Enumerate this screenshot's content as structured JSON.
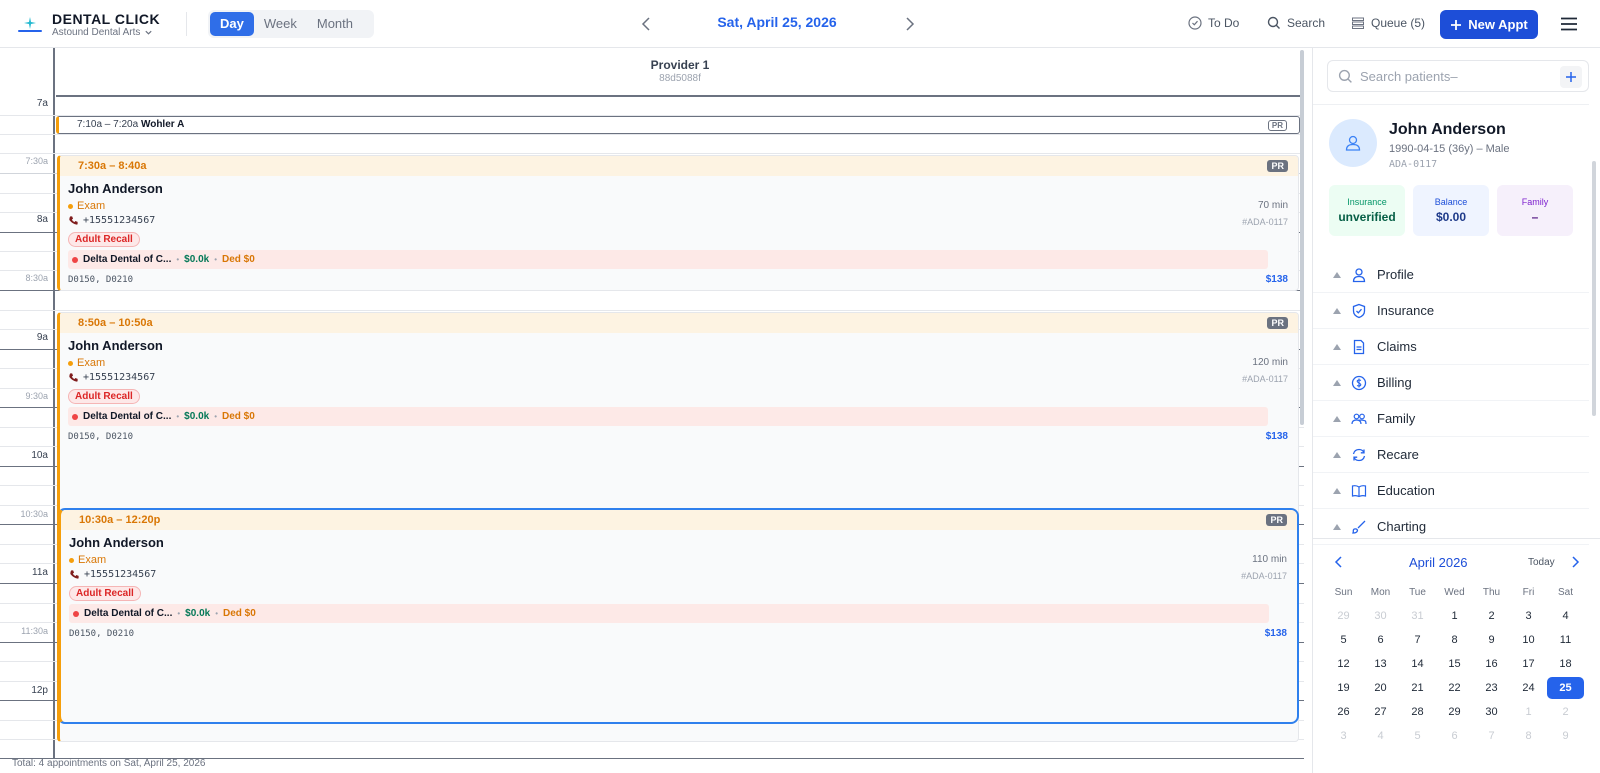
{
  "header": {
    "brand": "DENTAL CLICK",
    "practice": "Astound Dental Arts",
    "views": [
      "Day",
      "Week",
      "Month"
    ],
    "active_view": "Day",
    "date": "Sat, April 25, 2026",
    "todo_label": "To Do",
    "search_label": "Search",
    "queue_label": "Queue (5)",
    "new_appt_label": "New Appt"
  },
  "schedule": {
    "provider_name": "Provider 1",
    "provider_id": "88d5088f",
    "time_labels": {
      "t7": "7a",
      "t730": "7:30a",
      "t8": "8a",
      "t830": "8:30a",
      "t9": "9a",
      "t930": "9:30a",
      "t10": "10a",
      "t1030": "10:30a",
      "t11": "11a",
      "t1130": "11:30a",
      "t12": "12p"
    },
    "small_appt": {
      "time": "7:10a – 7:20a",
      "name": "Wohler A",
      "badge": "PR"
    },
    "appointments": [
      {
        "time": "7:30a – 8:40a",
        "badge": "PR",
        "name": "John Anderson",
        "type": "Exam",
        "phone": "+15551234567",
        "recall": "Adult Recall",
        "carrier": "Delta Dental of C...",
        "amount": "$0.0k",
        "ded": "Ded $0",
        "codes": "D0150, D0210",
        "duration": "70 min",
        "pid": "#ADA-0117",
        "price": "$138"
      },
      {
        "time": "8:50a – 10:50a",
        "badge": "PR",
        "name": "John Anderson",
        "type": "Exam",
        "phone": "+15551234567",
        "recall": "Adult Recall",
        "carrier": "Delta Dental of C...",
        "amount": "$0.0k",
        "ded": "Ded $0",
        "codes": "D0150, D0210",
        "duration": "120 min",
        "pid": "#ADA-0117",
        "price": "$138"
      },
      {
        "time": "10:30a – 12:20p",
        "badge": "PR",
        "name": "John Anderson",
        "type": "Exam",
        "phone": "+15551234567",
        "recall": "Adult Recall",
        "carrier": "Delta Dental of C...",
        "amount": "$0.0k",
        "ded": "Ded $0",
        "codes": "D0150, D0210",
        "duration": "110 min",
        "pid": "#ADA-0117",
        "price": "$138"
      }
    ],
    "footer": "Total: 4 appointments on Sat, April 25, 2026"
  },
  "panel": {
    "search_placeholder": "Search patients–",
    "patient": {
      "name": "John Anderson",
      "dob": "1990-04-15 (36y) – Male",
      "code": "ADA-0117",
      "insurance_label": "Insurance",
      "insurance_value": "unverified",
      "balance_label": "Balance",
      "balance_value": "$0.00",
      "family_label": "Family",
      "family_value": "–"
    },
    "menu": [
      "Profile",
      "Insurance",
      "Claims",
      "Billing",
      "Family",
      "Recare",
      "Education",
      "Charting"
    ],
    "calendar": {
      "month": "April 2026",
      "today_label": "Today",
      "dow": [
        "Sun",
        "Mon",
        "Tue",
        "Wed",
        "Thu",
        "Fri",
        "Sat"
      ],
      "weeks": [
        [
          "29",
          "30",
          "31",
          "1",
          "2",
          "3",
          "4"
        ],
        [
          "5",
          "6",
          "7",
          "8",
          "9",
          "10",
          "11"
        ],
        [
          "12",
          "13",
          "14",
          "15",
          "16",
          "17",
          "18"
        ],
        [
          "19",
          "20",
          "21",
          "22",
          "23",
          "24",
          "25"
        ],
        [
          "26",
          "27",
          "28",
          "29",
          "30",
          "1",
          "2"
        ],
        [
          "3",
          "4",
          "5",
          "6",
          "7",
          "8",
          "9"
        ]
      ],
      "selected": "25"
    }
  },
  "colors": {
    "accent": "#2563eb",
    "appointment_bar": "#f59e0b",
    "selected_border": "#2f80ed"
  }
}
